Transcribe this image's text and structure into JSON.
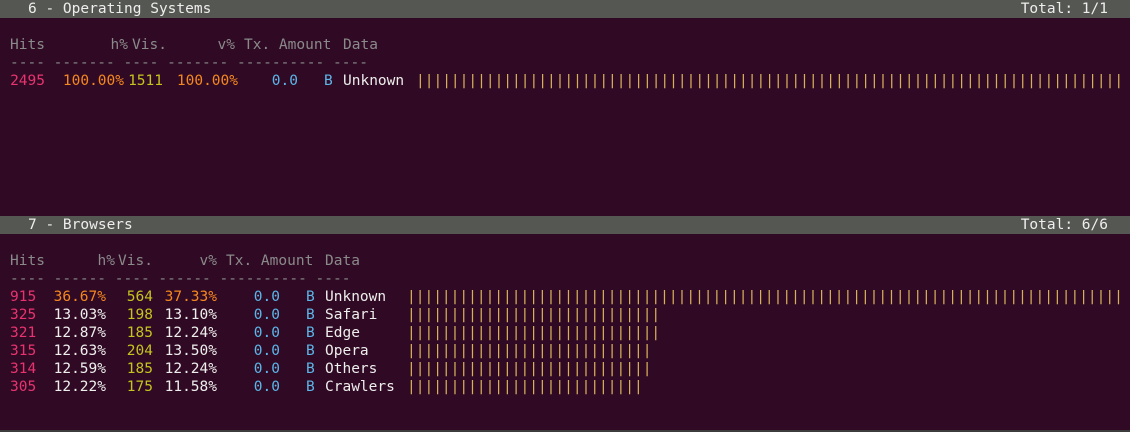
{
  "colors": {
    "background": "#300a24",
    "header_bar": "#555753",
    "hits": "#e8336f",
    "percent": "#f5871f",
    "visitors": "#c4c41f",
    "amount": "#5cb6ea",
    "bars": "#d6b15a"
  },
  "panels": [
    {
      "title": "6 - Operating Systems",
      "total": "Total: 1/1",
      "columns": {
        "hits": "Hits",
        "hpct": "h%",
        "vis": "Vis.",
        "vpct": "v%",
        "tx": "Tx. Amount",
        "data": "Data"
      },
      "dashes": "---- ------- ---- ------- ---------- ----",
      "rows": [
        {
          "hits": "2495",
          "hpct": "100.00%",
          "vis": "1511",
          "vpct": "100.00%",
          "amount": "0.0",
          "unit": "B",
          "label": "Unknown",
          "bar_fraction": 1.0
        }
      ]
    },
    {
      "title": "7 - Browsers",
      "total": "Total: 6/6",
      "columns": {
        "hits": "Hits",
        "hpct": "h%",
        "vis": "Vis.",
        "vpct": "v%",
        "tx": "Tx. Amount",
        "data": "Data"
      },
      "dashes": "---- ------ ---- ------ ---------- ----",
      "rows": [
        {
          "hits": "915",
          "hpct": "36.67%",
          "vis": "564",
          "vpct": "37.33%",
          "amount": "0.0",
          "unit": "B",
          "label": "Unknown",
          "bar_fraction": 1.0
        },
        {
          "hits": "325",
          "hpct": "13.03%",
          "vis": "198",
          "vpct": "13.10%",
          "amount": "0.0",
          "unit": "B",
          "label": "Safari",
          "bar_fraction": 0.355
        },
        {
          "hits": "321",
          "hpct": "12.87%",
          "vis": "185",
          "vpct": "12.24%",
          "amount": "0.0",
          "unit": "B",
          "label": "Edge",
          "bar_fraction": 0.351
        },
        {
          "hits": "315",
          "hpct": "12.63%",
          "vis": "204",
          "vpct": "13.50%",
          "amount": "0.0",
          "unit": "B",
          "label": "Opera",
          "bar_fraction": 0.344
        },
        {
          "hits": "314",
          "hpct": "12.59%",
          "vis": "185",
          "vpct": "12.24%",
          "amount": "0.0",
          "unit": "B",
          "label": "Others",
          "bar_fraction": 0.343
        },
        {
          "hits": "305",
          "hpct": "12.22%",
          "vis": "175",
          "vpct": "11.58%",
          "amount": "0.0",
          "unit": "B",
          "label": "Crawlers",
          "bar_fraction": 0.333
        }
      ]
    }
  ]
}
